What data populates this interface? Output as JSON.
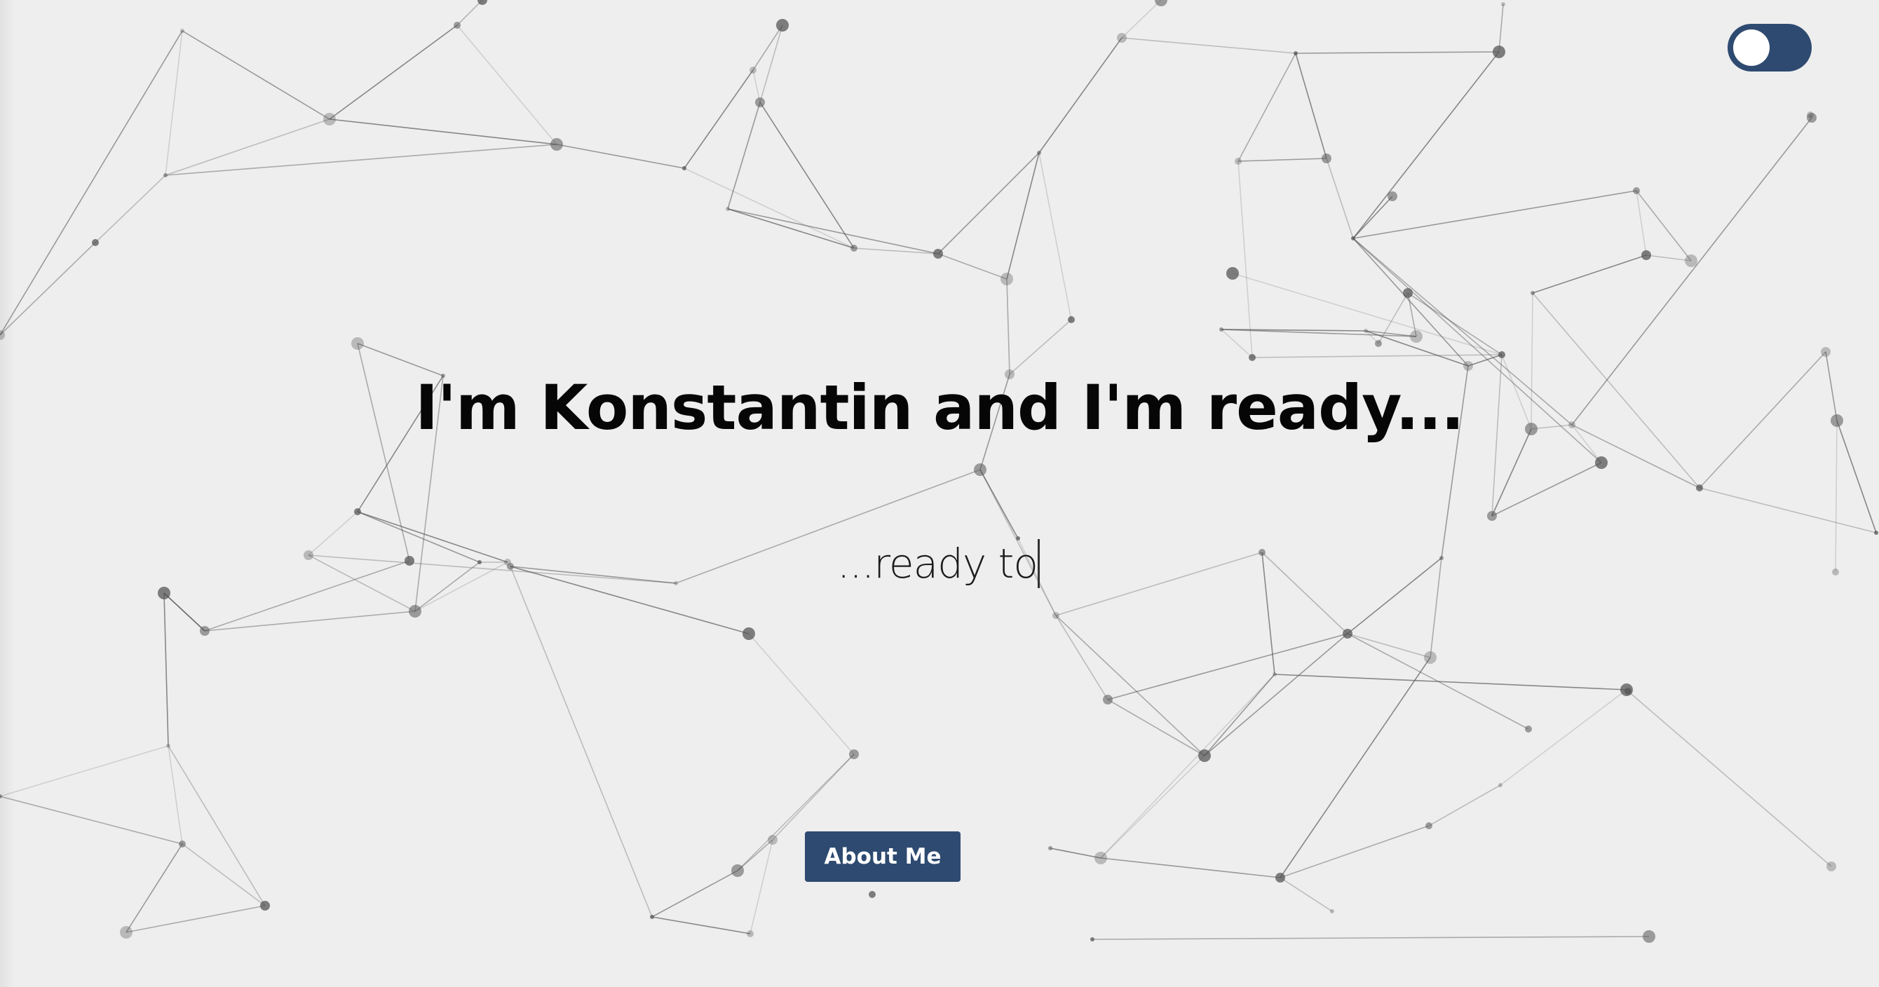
{
  "hero": {
    "headline": "I'm Konstantin and I'm ready...",
    "typed_text": "...ready to"
  },
  "about_button": {
    "label": "About Me"
  },
  "theme_toggle": {
    "state": "dark-off"
  },
  "colors": {
    "background": "#eeeeee",
    "accent": "#2e4a70",
    "network_lines": "#555555",
    "headline": "#060606"
  },
  "icons": {
    "toggle": "toggle-switch-icon"
  }
}
